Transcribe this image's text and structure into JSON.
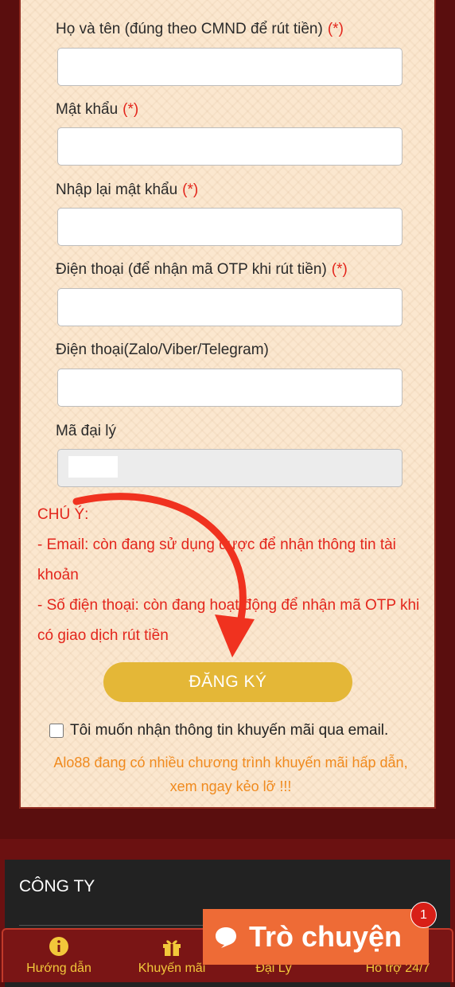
{
  "form": {
    "fields": [
      {
        "label": "Họ và tên (đúng theo CMND để rút tiền)",
        "required": "(*)"
      },
      {
        "label": "Mật khẩu",
        "required": "(*)"
      },
      {
        "label": "Nhập lại mật khẩu",
        "required": "(*)"
      },
      {
        "label": "Điện thoại (để nhận mã OTP khi rút tiền)",
        "required": "(*)"
      },
      {
        "label": "Điện thoại(Zalo/Viber/Telegram)",
        "required": ""
      },
      {
        "label": "Mã đại lý",
        "required": ""
      }
    ],
    "note_title": "CHÚ Ý:",
    "note_line1": "- Email: còn đang sử dụng được để nhận thông tin tài khoản",
    "note_line2": "- Số điện thoại: còn đang hoạt động để nhận mã OTP khi có giao dịch rút tiền",
    "register_label": "ĐĂNG KÝ",
    "optin_label": "Tôi muốn nhận thông tin khuyến mãi qua email.",
    "promo_text": "Alo88 đang có nhiều chương trình khuyến mãi hấp dẫn, xem ngay kẻo lỡ !!!"
  },
  "footer": {
    "company_heading": "CÔNG TY"
  },
  "bottom_nav": {
    "items": [
      {
        "label": "Hướng dẫn",
        "icon": "info-icon"
      },
      {
        "label": "Khuyến mãi",
        "icon": "gift-icon"
      },
      {
        "label": "Đại Lý",
        "icon": "agent-icon"
      },
      {
        "label": "Hỗ trợ 24/7",
        "icon": "support-icon"
      }
    ]
  },
  "chat": {
    "label": "Trò chuyện",
    "badge": "1"
  },
  "colors": {
    "accent_red": "#e3261c",
    "button_gold": "#e4b737",
    "nav_gold": "#f2c83a",
    "chat_orange": "#ee6b36"
  }
}
